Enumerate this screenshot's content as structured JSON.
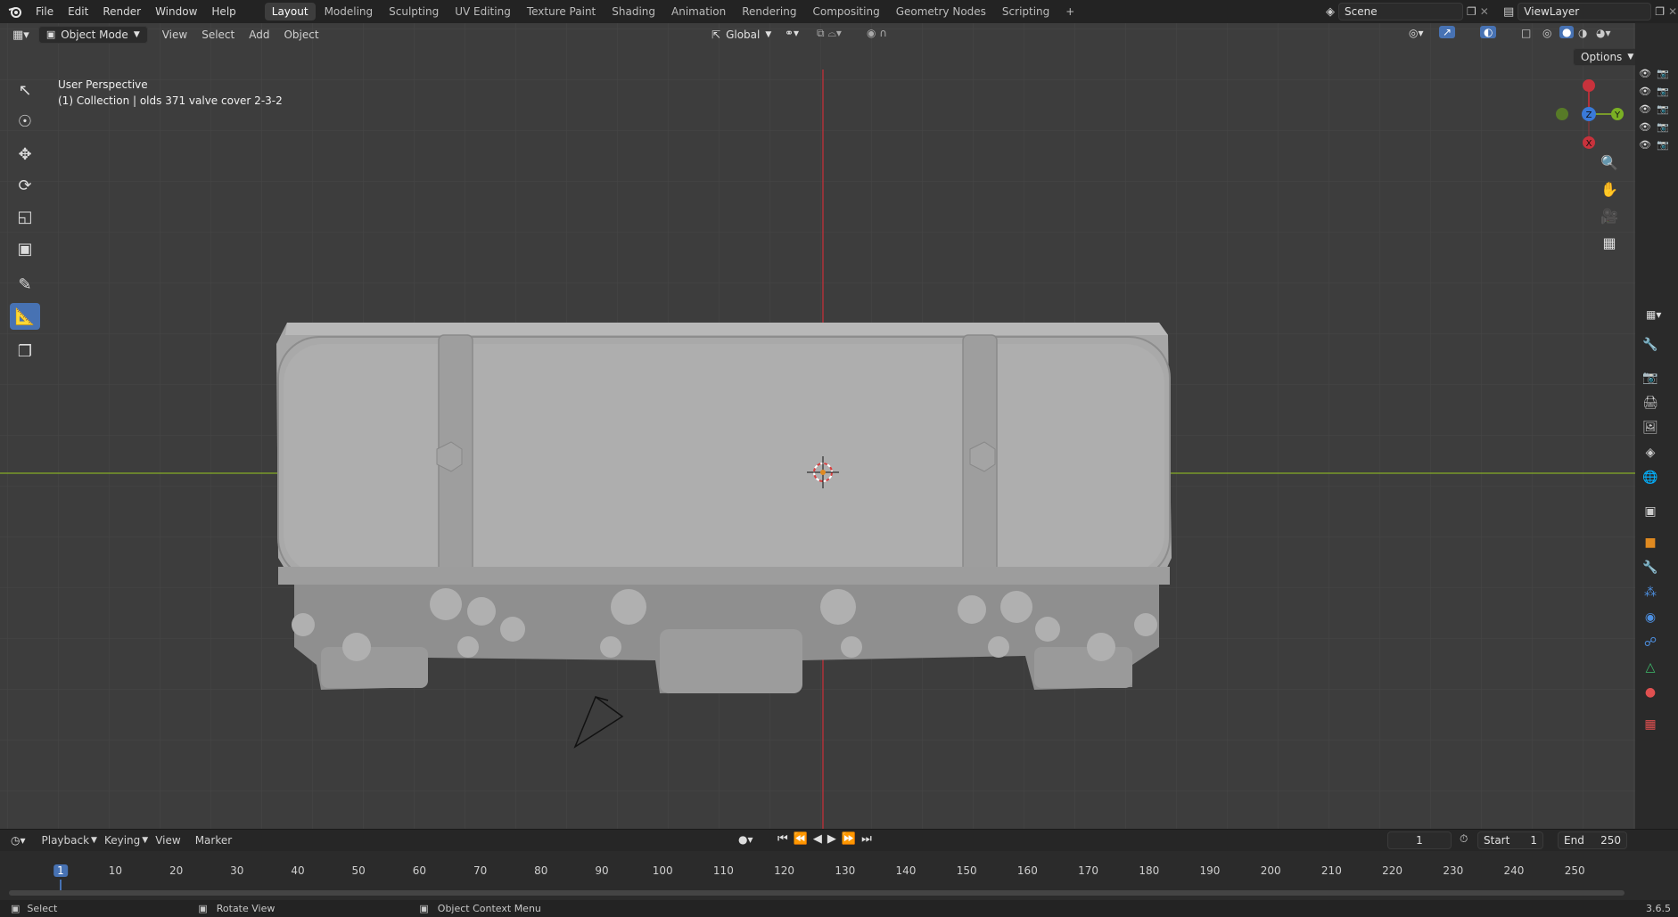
{
  "topbar": {
    "menus": [
      "File",
      "Edit",
      "Render",
      "Window",
      "Help"
    ],
    "workspaces": [
      "Layout",
      "Modeling",
      "Sculpting",
      "UV Editing",
      "Texture Paint",
      "Shading",
      "Animation",
      "Rendering",
      "Compositing",
      "Geometry Nodes",
      "Scripting"
    ],
    "active_workspace": "Layout",
    "add_tab": "+",
    "scene": "Scene",
    "view_layer": "ViewLayer"
  },
  "header": {
    "mode": "Object Mode",
    "menus": [
      "View",
      "Select",
      "Add",
      "Object"
    ],
    "orientation": "Global",
    "options": "Options"
  },
  "viewport": {
    "perspective": "User Perspective",
    "collection": "(1) Collection | olds 371 valve cover 2-3-2",
    "gizmo": {
      "x": "X",
      "y": "Y",
      "z": "Z"
    },
    "background_color": "#3d3d3d",
    "grid_color": "#464646",
    "x_axis_color": "#7a9a2a",
    "y_axis_color": "#b0323a",
    "model_color": "#a6a6a6"
  },
  "timeline": {
    "menus": [
      "Playback",
      "Keying",
      "View",
      "Marker"
    ],
    "current_frame": "1",
    "start_label": "Start",
    "start": "1",
    "end_label": "End",
    "end": "250",
    "ticks": [
      "1",
      "10",
      "20",
      "30",
      "40",
      "50",
      "60",
      "70",
      "80",
      "90",
      "100",
      "110",
      "120",
      "130",
      "140",
      "150",
      "160",
      "170",
      "180",
      "190",
      "200",
      "210",
      "220",
      "230",
      "240",
      "250"
    ],
    "playhead_color": "#4772b3"
  },
  "statusbar": {
    "select": "Select",
    "rotate": "Rotate View",
    "context": "Object Context Menu",
    "version": "3.6.5"
  },
  "tools": [
    "select-box-icon",
    "cursor-icon",
    "move-icon",
    "rotate-icon",
    "scale-icon",
    "transform-icon",
    "annotate-icon",
    "measure-icon",
    "add-cube-icon"
  ],
  "accent_color": "#4772b3"
}
